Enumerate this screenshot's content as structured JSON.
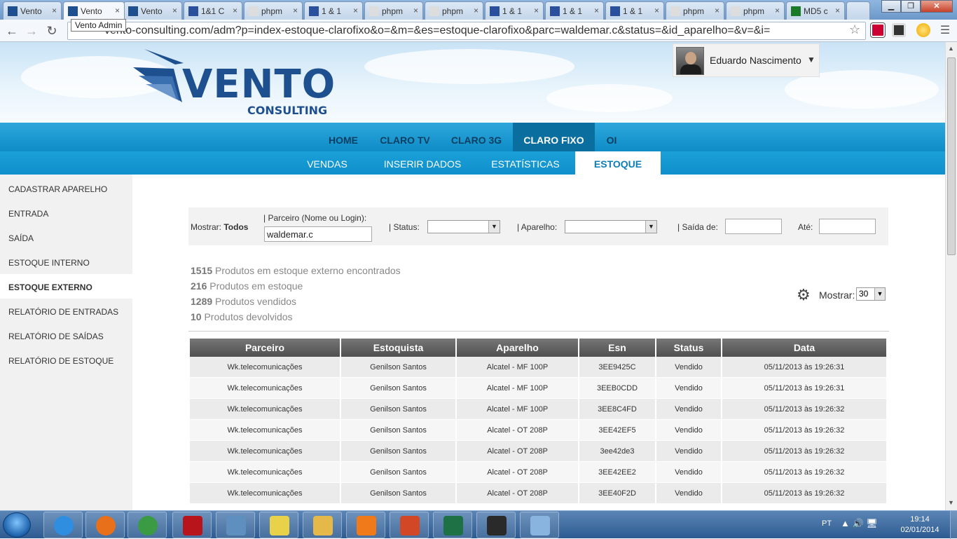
{
  "browser": {
    "tabs": [
      {
        "label": "Vento",
        "icon": "vento-favicon"
      },
      {
        "label": "Vento",
        "icon": "vento-favicon",
        "active": true
      },
      {
        "label": "Vento",
        "icon": "vento-favicon"
      },
      {
        "label": "1&1 C",
        "icon": "1and1-favicon"
      },
      {
        "label": "phpm",
        "icon": "page-favicon"
      },
      {
        "label": "1 & 1",
        "icon": "1and1-favicon"
      },
      {
        "label": "phpm",
        "icon": "page-favicon"
      },
      {
        "label": "phpm",
        "icon": "page-favicon"
      },
      {
        "label": "1 & 1",
        "icon": "1and1-favicon"
      },
      {
        "label": "1 & 1",
        "icon": "1and1-favicon"
      },
      {
        "label": "1 & 1",
        "icon": "1and1-favicon"
      },
      {
        "label": "phpm",
        "icon": "page-favicon"
      },
      {
        "label": "phpm",
        "icon": "page-favicon"
      },
      {
        "label": "MD5 c",
        "icon": "md5-favicon"
      }
    ],
    "tooltip": "Vento Admin",
    "url": "vento-consulting.com/adm?p=index-estoque-clarofixo&o=&m=&es=estoque-clarofixo&parc=waldemar.c&status=&id_aparelho=&v=&i="
  },
  "header": {
    "logo_text": "VENTO",
    "logo_sub": "CONSULTING",
    "user_name": "Eduardo Nascimento",
    "user_caret": "▼"
  },
  "nav": {
    "main": [
      "HOME",
      "CLARO TV",
      "CLARO 3G",
      "CLARO FIXO",
      "OI"
    ],
    "main_active": "CLARO FIXO",
    "sub": [
      "VENDAS",
      "INSERIR DADOS",
      "ESTATÍSTICAS",
      "ESTOQUE"
    ],
    "sub_active": "ESTOQUE"
  },
  "sidebar": {
    "items": [
      "CADASTRAR APARELHO",
      "ENTRADA",
      "SAÍDA",
      "ESTOQUE INTERNO",
      "ESTOQUE EXTERNO",
      "RELATÓRIO DE ENTRADAS",
      "RELATÓRIO DE SAÍDAS",
      "RELATÓRIO DE ESTOQUE"
    ],
    "active": "ESTOQUE EXTERNO"
  },
  "filter": {
    "show_label": "Mostrar:",
    "show_value": "Todos",
    "partner_label": "| Parceiro (Nome ou Login):",
    "partner_value": "waldemar.c",
    "status_label": "| Status:",
    "device_label": "| Aparelho:",
    "from_label": "| Saída de:",
    "to_label": "Até:"
  },
  "stats": [
    {
      "count": "1515",
      "text": "Produtos em estoque externo encontrados"
    },
    {
      "count": "216",
      "text": "Produtos em estoque"
    },
    {
      "count": "1289",
      "text": "Produtos vendidos"
    },
    {
      "count": "10",
      "text": "Produtos devolvidos"
    }
  ],
  "page_size": {
    "label": "Mostrar:",
    "value": "30"
  },
  "table": {
    "columns": [
      "Parceiro",
      "Estoquista",
      "Aparelho",
      "Esn",
      "Status",
      "Data"
    ],
    "rows": [
      [
        "Wk.telecomunicações",
        "Genilson Santos",
        "Alcatel - MF 100P",
        "3EE9425C",
        "Vendido",
        "05/11/2013 às 19:26:31"
      ],
      [
        "Wk.telecomunicações",
        "Genilson Santos",
        "Alcatel - MF 100P",
        "3EEB0CDD",
        "Vendido",
        "05/11/2013 às 19:26:31"
      ],
      [
        "Wk.telecomunicações",
        "Genilson Santos",
        "Alcatel - MF 100P",
        "3EE8C4FD",
        "Vendido",
        "05/11/2013 às 19:26:32"
      ],
      [
        "Wk.telecomunicações",
        "Genilson Santos",
        "Alcatel - OT 208P",
        "3EE42EF5",
        "Vendido",
        "05/11/2013 às 19:26:32"
      ],
      [
        "Wk.telecomunicações",
        "Genilson Santos",
        "Alcatel - OT 208P",
        "3ee42de3",
        "Vendido",
        "05/11/2013 às 19:26:32"
      ],
      [
        "Wk.telecomunicações",
        "Genilson Santos",
        "Alcatel - OT 208P",
        "3EE42EE2",
        "Vendido",
        "05/11/2013 às 19:26:32"
      ],
      [
        "Wk.telecomunicações",
        "Genilson Santos",
        "Alcatel - OT 208P",
        "3EE40F2D",
        "Vendido",
        "05/11/2013 às 19:26:32"
      ]
    ]
  },
  "taskbar": {
    "apps": [
      "internet-explorer",
      "firefox",
      "chrome",
      "filezilla",
      "image-viewer",
      "notes",
      "file-explorer",
      "avast",
      "powerpoint",
      "excel",
      "chart-app",
      "paint"
    ],
    "lang": "PT",
    "time": "19:14",
    "date": "02/01/2014"
  },
  "colors": {
    "nav_bg": "#1ba0d8",
    "nav_active": "#0a6f9f",
    "brand": "#1e4f8f",
    "table_header": "#5a5a5a"
  }
}
